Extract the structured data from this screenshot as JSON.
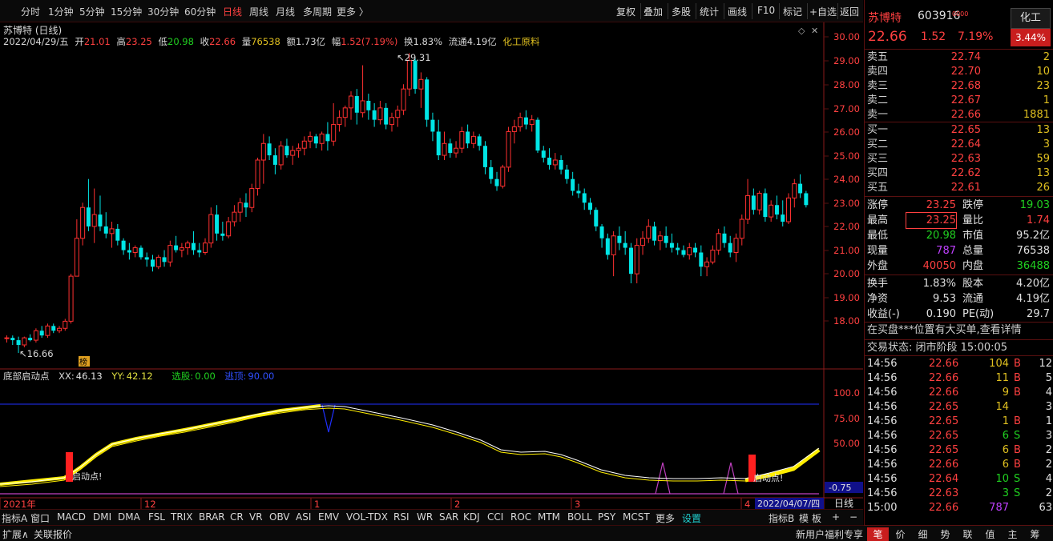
{
  "topbar": {
    "periods": [
      "分时",
      "1分钟",
      "5分钟",
      "15分钟",
      "30分钟",
      "60分钟",
      "日线",
      "周线",
      "月线",
      "多周期",
      "更多 〉"
    ],
    "active_period": "日线",
    "tools": [
      "复权",
      "叠加",
      "多股",
      "统计",
      "画线",
      "F10",
      "标记",
      "+自选",
      "返回"
    ]
  },
  "chart": {
    "stock_title": "苏博特 (日线)",
    "info": {
      "date": "2022/04/29/五",
      "open_label": "开",
      "open": "21.01",
      "high_label": "高",
      "high": "23.25",
      "low_label": "低",
      "low": "20.98",
      "close_label": "收",
      "close": "22.66",
      "volume_label": "量",
      "volume": "76538",
      "amount_label": "额",
      "amount": "1.73亿",
      "amp_label": "幅",
      "amp": "1.52(7.19%)",
      "turnover_label": "换",
      "turnover": "1.83%",
      "float_label": "流通",
      "float": "4.19亿",
      "industry": "化工原料"
    },
    "price_axis": [
      "30.00",
      "29.00",
      "28.00",
      "27.00",
      "26.00",
      "25.00",
      "24.00",
      "23.00",
      "22.00",
      "21.00",
      "20.00",
      "19.00",
      "18.00"
    ],
    "max_label": "29.31",
    "min_label": "16.66",
    "bang_label": "榜",
    "indicator": {
      "name": "底部启动点",
      "xx_label": "XX:",
      "xx": "46.13",
      "yy_label": "YY:",
      "yy": "42.12",
      "select_label": "选股:",
      "select": "0.00",
      "top_label": "逃顶:",
      "top": "90.00",
      "axis": [
        "100.0",
        "75.00",
        "50.00"
      ],
      "cursor_value": "-0.75",
      "signal_text": "启动点!"
    },
    "time_axis": {
      "labels": [
        "2021年",
        "12",
        "1",
        "2",
        "3",
        "4"
      ],
      "cursor_date": "2022/04/07/四",
      "period_label": "日线"
    }
  },
  "chart_data": {
    "type": "candlestick",
    "title": "苏博特 (日线)",
    "ylim": [
      17.3,
      30.3
    ],
    "candles": [
      [
        17.3,
        17.4,
        17.1,
        17.3
      ],
      [
        17.3,
        17.4,
        17.0,
        17.2
      ],
      [
        17.2,
        17.35,
        16.66,
        17.0
      ],
      [
        17.0,
        17.35,
        16.9,
        17.3
      ],
      [
        17.3,
        17.45,
        17.15,
        17.2
      ],
      [
        17.2,
        17.7,
        17.1,
        17.6
      ],
      [
        17.6,
        17.8,
        17.3,
        17.4
      ],
      [
        17.4,
        17.9,
        17.3,
        17.8
      ],
      [
        17.8,
        17.9,
        17.5,
        17.6
      ],
      [
        17.6,
        17.8,
        17.5,
        17.7
      ],
      [
        17.7,
        18.1,
        17.6,
        18.0
      ],
      [
        18.0,
        20.0,
        17.9,
        19.9
      ],
      [
        19.9,
        22.3,
        20.2,
        21.5
      ],
      [
        21.5,
        23.0,
        21.2,
        22.8
      ],
      [
        22.8,
        24.0,
        21.8,
        22.0
      ],
      [
        22.0,
        23.6,
        21.3,
        22.5
      ],
      [
        22.5,
        23.3,
        21.8,
        22.0
      ],
      [
        22.0,
        22.6,
        21.5,
        21.7
      ],
      [
        21.7,
        22.2,
        21.1,
        21.9
      ],
      [
        21.9,
        22.1,
        21.2,
        21.4
      ],
      [
        21.4,
        21.5,
        20.8,
        21.0
      ],
      [
        21.0,
        21.3,
        20.6,
        20.9
      ],
      [
        20.9,
        21.2,
        20.7,
        21.1
      ],
      [
        21.1,
        21.2,
        20.6,
        20.7
      ],
      [
        20.7,
        20.9,
        20.3,
        20.6
      ],
      [
        20.6,
        20.8,
        20.1,
        20.3
      ],
      [
        20.3,
        20.8,
        20.2,
        20.7
      ],
      [
        20.7,
        21.0,
        20.3,
        20.5
      ],
      [
        20.5,
        21.4,
        20.3,
        21.2
      ],
      [
        21.2,
        21.6,
        20.9,
        21.0
      ],
      [
        21.0,
        21.3,
        20.7,
        21.1
      ],
      [
        21.1,
        21.4,
        20.8,
        21.3
      ],
      [
        21.3,
        21.8,
        20.8,
        21.0
      ],
      [
        21.0,
        21.3,
        20.7,
        20.9
      ],
      [
        20.9,
        21.5,
        20.8,
        21.3
      ],
      [
        21.3,
        22.8,
        21.1,
        22.5
      ],
      [
        22.5,
        22.9,
        21.4,
        21.7
      ],
      [
        21.7,
        22.2,
        21.4,
        21.6
      ],
      [
        21.6,
        22.4,
        21.5,
        22.2
      ],
      [
        22.2,
        22.9,
        22.0,
        22.6
      ],
      [
        22.6,
        23.2,
        22.2,
        23.0
      ],
      [
        23.0,
        23.4,
        22.4,
        22.8
      ],
      [
        22.8,
        23.8,
        22.6,
        23.6
      ],
      [
        23.6,
        24.9,
        23.3,
        24.8
      ],
      [
        24.8,
        25.9,
        23.8,
        25.5
      ],
      [
        25.5,
        25.8,
        24.8,
        25.0
      ],
      [
        25.0,
        25.3,
        24.2,
        24.6
      ],
      [
        24.6,
        25.6,
        24.4,
        25.4
      ],
      [
        25.4,
        25.7,
        24.9,
        25.0
      ],
      [
        25.0,
        25.4,
        24.6,
        25.2
      ],
      [
        25.2,
        25.5,
        24.9,
        25.3
      ],
      [
        25.3,
        25.8,
        25.0,
        25.6
      ],
      [
        25.6,
        26.0,
        25.3,
        25.8
      ],
      [
        25.8,
        25.9,
        25.3,
        25.5
      ],
      [
        25.5,
        26.0,
        25.2,
        25.9
      ],
      [
        25.9,
        26.4,
        25.2,
        25.6
      ],
      [
        25.6,
        27.2,
        25.4,
        26.3
      ],
      [
        26.3,
        26.9,
        26.0,
        26.6
      ],
      [
        26.6,
        27.1,
        26.2,
        27.0
      ],
      [
        27.0,
        27.7,
        26.5,
        27.5
      ],
      [
        27.5,
        27.8,
        26.3,
        26.8
      ],
      [
        26.8,
        28.8,
        26.6,
        27.3
      ],
      [
        27.3,
        27.6,
        26.5,
        26.9
      ],
      [
        26.9,
        27.2,
        26.2,
        26.5
      ],
      [
        26.5,
        27.3,
        26.3,
        27.0
      ],
      [
        27.0,
        27.2,
        26.1,
        26.3
      ],
      [
        26.3,
        26.8,
        26.0,
        26.6
      ],
      [
        26.6,
        27.1,
        26.2,
        26.9
      ],
      [
        26.9,
        28.0,
        26.7,
        27.8
      ],
      [
        27.8,
        29.31,
        27.5,
        29.0
      ],
      [
        29.0,
        29.1,
        27.6,
        27.8
      ],
      [
        27.8,
        28.5,
        27.0,
        28.2
      ],
      [
        28.2,
        28.3,
        26.2,
        26.5
      ],
      [
        26.5,
        26.8,
        25.6,
        26.0
      ],
      [
        26.0,
        26.5,
        24.8,
        25.0
      ],
      [
        25.0,
        26.0,
        24.8,
        25.5
      ],
      [
        25.5,
        25.7,
        24.9,
        25.1
      ],
      [
        25.1,
        25.6,
        24.9,
        25.3
      ],
      [
        25.3,
        26.2,
        25.1,
        26.0
      ],
      [
        26.0,
        26.3,
        25.3,
        25.5
      ],
      [
        25.5,
        26.0,
        25.3,
        25.8
      ],
      [
        25.8,
        25.9,
        25.2,
        25.4
      ],
      [
        25.4,
        25.6,
        24.2,
        24.5
      ],
      [
        24.5,
        24.8,
        23.8,
        24.0
      ],
      [
        24.0,
        24.3,
        23.5,
        23.7
      ],
      [
        23.7,
        24.6,
        23.6,
        24.5
      ],
      [
        24.5,
        26.2,
        24.3,
        26.0
      ],
      [
        26.0,
        26.5,
        25.5,
        26.2
      ],
      [
        26.2,
        26.8,
        26.0,
        26.6
      ],
      [
        26.6,
        26.9,
        26.1,
        26.3
      ],
      [
        26.3,
        26.7,
        26.0,
        26.5
      ],
      [
        26.5,
        26.6,
        25.1,
        25.2
      ],
      [
        25.2,
        25.4,
        24.7,
        24.9
      ],
      [
        24.9,
        25.3,
        24.4,
        24.6
      ],
      [
        24.6,
        25.1,
        24.4,
        24.8
      ],
      [
        24.8,
        25.0,
        24.2,
        24.4
      ],
      [
        24.4,
        24.6,
        23.8,
        24.0
      ],
      [
        24.0,
        24.3,
        23.3,
        23.5
      ],
      [
        23.5,
        23.8,
        23.2,
        23.4
      ],
      [
        23.4,
        23.6,
        22.7,
        23.0
      ],
      [
        23.0,
        23.2,
        22.5,
        22.7
      ],
      [
        22.7,
        22.8,
        21.8,
        22.0
      ],
      [
        22.0,
        22.1,
        21.1,
        21.5
      ],
      [
        21.5,
        21.7,
        20.6,
        20.8
      ],
      [
        20.8,
        21.8,
        19.9,
        21.6
      ],
      [
        21.6,
        22.0,
        21.0,
        21.3
      ],
      [
        21.3,
        21.8,
        20.8,
        21.1
      ],
      [
        21.1,
        21.3,
        19.6,
        20.0
      ],
      [
        20.0,
        21.5,
        19.6,
        21.2
      ],
      [
        21.2,
        21.8,
        20.8,
        21.5
      ],
      [
        21.5,
        22.3,
        21.3,
        22.0
      ],
      [
        22.0,
        22.2,
        21.2,
        21.4
      ],
      [
        21.4,
        21.8,
        21.0,
        21.6
      ],
      [
        21.6,
        22.0,
        21.1,
        21.3
      ],
      [
        21.3,
        21.7,
        20.9,
        21.1
      ],
      [
        21.1,
        21.3,
        20.8,
        21.0
      ],
      [
        21.0,
        21.2,
        20.7,
        20.8
      ],
      [
        20.8,
        21.3,
        20.6,
        21.1
      ],
      [
        21.1,
        21.3,
        20.7,
        20.9
      ],
      [
        20.9,
        21.2,
        19.9,
        20.3
      ],
      [
        20.3,
        20.7,
        19.9,
        20.5
      ],
      [
        20.5,
        21.2,
        20.4,
        21.0
      ],
      [
        21.0,
        21.9,
        20.8,
        21.7
      ],
      [
        21.7,
        22.0,
        21.1,
        21.3
      ],
      [
        21.3,
        21.6,
        20.7,
        20.9
      ],
      [
        20.9,
        21.7,
        20.5,
        21.5
      ],
      [
        21.5,
        22.5,
        21.2,
        22.3
      ],
      [
        22.3,
        24.0,
        22.1,
        23.3
      ],
      [
        23.3,
        23.6,
        22.5,
        22.7
      ],
      [
        22.7,
        23.5,
        22.5,
        23.4
      ],
      [
        23.4,
        23.6,
        22.2,
        22.4
      ],
      [
        22.4,
        23.1,
        22.2,
        22.9
      ],
      [
        22.9,
        23.3,
        22.3,
        22.5
      ],
      [
        22.5,
        23.1,
        22.0,
        22.2
      ],
      [
        22.2,
        23.4,
        22.1,
        23.2
      ],
      [
        23.2,
        24.0,
        22.8,
        23.8
      ],
      [
        23.8,
        24.2,
        23.2,
        23.4
      ],
      [
        23.4,
        23.5,
        22.8,
        22.9
      ]
    ]
  },
  "quote": {
    "name": "苏博特",
    "code": "603916",
    "superscript": "0000",
    "industry": "化工",
    "industry_pct": "3.44%",
    "price": "22.66",
    "change": "1.52",
    "change_pct": "7.19%",
    "asks": [
      {
        "label": "卖五",
        "price": "22.74",
        "vol": "2"
      },
      {
        "label": "卖四",
        "price": "22.70",
        "vol": "10"
      },
      {
        "label": "卖三",
        "price": "22.68",
        "vol": "23"
      },
      {
        "label": "卖二",
        "price": "22.67",
        "vol": "1"
      },
      {
        "label": "卖一",
        "price": "22.66",
        "vol": "1881"
      }
    ],
    "bids": [
      {
        "label": "买一",
        "price": "22.65",
        "vol": "13"
      },
      {
        "label": "买二",
        "price": "22.64",
        "vol": "3"
      },
      {
        "label": "买三",
        "price": "22.63",
        "vol": "59"
      },
      {
        "label": "买四",
        "price": "22.62",
        "vol": "13"
      },
      {
        "label": "买五",
        "price": "22.61",
        "vol": "26"
      }
    ],
    "stats": [
      {
        "l1": "涨停",
        "v1": "23.25",
        "c1": "red",
        "l2": "跌停",
        "v2": "19.03",
        "c2": "green"
      },
      {
        "l1": "最高",
        "v1": "23.25",
        "c1": "red",
        "l2": "量比",
        "v2": "1.74",
        "c2": "red"
      },
      {
        "l1": "最低",
        "v1": "20.98",
        "c1": "green",
        "l2": "市值",
        "v2": "95.2亿",
        "c2": "white"
      },
      {
        "l1": "现量",
        "v1": "787",
        "c1": "purple",
        "l2": "总量",
        "v2": "76538",
        "c2": "white"
      },
      {
        "l1": "外盘",
        "v1": "40050",
        "c1": "red",
        "l2": "内盘",
        "v2": "36488",
        "c2": "green"
      },
      {
        "l1": "换手",
        "v1": "1.83%",
        "c1": "white",
        "l2": "股本",
        "v2": "4.20亿",
        "c2": "white"
      },
      {
        "l1": "净资",
        "v1": "9.53",
        "c1": "white",
        "l2": "流通",
        "v2": "4.19亿",
        "c2": "white"
      },
      {
        "l1": "收益(-)",
        "v1": "0.190",
        "c1": "white",
        "l2": "PE(动)",
        "v2": "29.7",
        "c2": "white"
      }
    ],
    "notice": "在买盘***位置有大买单,查看详情",
    "status": "交易状态: 闭市阶段 15:00:05",
    "ticks": [
      {
        "t": "14:56",
        "p": "22.66",
        "v": "104",
        "bs": "B",
        "n": "12"
      },
      {
        "t": "14:56",
        "p": "22.66",
        "v": "11",
        "bs": "B",
        "n": "5"
      },
      {
        "t": "14:56",
        "p": "22.66",
        "v": "9",
        "bs": "B",
        "n": "4"
      },
      {
        "t": "14:56",
        "p": "22.65",
        "v": "14",
        "bs": "",
        "n": "3"
      },
      {
        "t": "14:56",
        "p": "22.65",
        "v": "1",
        "bs": "B",
        "n": "1"
      },
      {
        "t": "14:56",
        "p": "22.65",
        "v": "6",
        "bs": "S",
        "n": "3"
      },
      {
        "t": "14:56",
        "p": "22.65",
        "v": "6",
        "bs": "B",
        "n": "2"
      },
      {
        "t": "14:56",
        "p": "22.66",
        "v": "6",
        "bs": "B",
        "n": "2"
      },
      {
        "t": "14:56",
        "p": "22.64",
        "v": "10",
        "bs": "S",
        "n": "4"
      },
      {
        "t": "14:56",
        "p": "22.63",
        "v": "3",
        "bs": "S",
        "n": "2"
      },
      {
        "t": "15:00",
        "p": "22.66",
        "v": "787",
        "bs": "",
        "n": "63"
      }
    ],
    "tabs": [
      "笔",
      "价",
      "细",
      "势",
      "联",
      "值",
      "主",
      "筹"
    ]
  },
  "bottom": {
    "indicator_tabs": [
      "指标A",
      "窗口",
      "MACD",
      "DMI",
      "DMA",
      "FSL",
      "TRIX",
      "BRAR",
      "CR",
      "VR",
      "OBV",
      "ASI",
      "EMV",
      "VOL-TDX",
      "RSI",
      "WR",
      "SAR",
      "KDJ",
      "CCI",
      "ROC",
      "MTM",
      "BOLL",
      "PSY",
      "MCST",
      "更多"
    ],
    "settings": "设置",
    "right_tabs": [
      "指标B",
      "模",
      "板",
      "+",
      "−"
    ],
    "expand": "扩展∧",
    "related": "关联报价",
    "promo": "新用户福利专享"
  }
}
